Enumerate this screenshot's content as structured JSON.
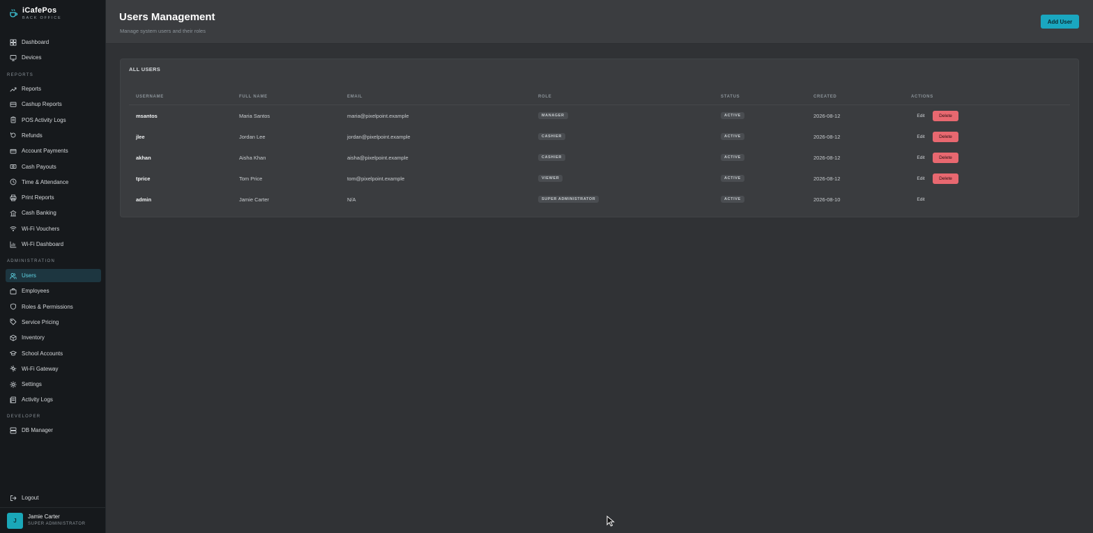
{
  "brand": {
    "name": "iCafePos",
    "subtitle": "BACK OFFICE"
  },
  "sidebar": {
    "top_items": [
      {
        "label": "Dashboard",
        "icon": "dashboard-icon"
      },
      {
        "label": "Devices",
        "icon": "monitor-icon"
      }
    ],
    "reports_title": "REPORTS",
    "reports_items": [
      {
        "label": "Reports",
        "icon": "trend-icon"
      },
      {
        "label": "Cashup Reports",
        "icon": "register-icon"
      },
      {
        "label": "POS Activity Logs",
        "icon": "clipboard-icon"
      },
      {
        "label": "Refunds",
        "icon": "refund-icon"
      },
      {
        "label": "Account Payments",
        "icon": "card-icon"
      },
      {
        "label": "Cash Payouts",
        "icon": "cash-icon"
      },
      {
        "label": "Time & Attendance",
        "icon": "clock-icon"
      },
      {
        "label": "Print Reports",
        "icon": "printer-icon"
      },
      {
        "label": "Cash Banking",
        "icon": "bank-icon"
      },
      {
        "label": "Wi-Fi Vouchers",
        "icon": "wifi-icon"
      },
      {
        "label": "Wi-Fi Dashboard",
        "icon": "bar-chart-icon"
      }
    ],
    "admin_title": "ADMINISTRATION",
    "admin_items": [
      {
        "label": "Users",
        "icon": "users-icon",
        "active": true
      },
      {
        "label": "Employees",
        "icon": "briefcase-icon"
      },
      {
        "label": "Roles & Permissions",
        "icon": "shield-icon"
      },
      {
        "label": "Service Pricing",
        "icon": "tag-icon"
      },
      {
        "label": "Inventory",
        "icon": "box-icon"
      },
      {
        "label": "School Accounts",
        "icon": "graduation-cap-icon"
      },
      {
        "label": "Wi-Fi Gateway",
        "icon": "gateway-icon"
      },
      {
        "label": "Settings",
        "icon": "gear-icon"
      },
      {
        "label": "Activity Logs",
        "icon": "log-icon"
      }
    ],
    "developer_title": "DEVELOPER",
    "developer_items": [
      {
        "label": "DB Manager",
        "icon": "database-icon"
      }
    ],
    "logout_label": "Logout",
    "user": {
      "initial": "J",
      "name": "Jamie Carter",
      "role": "SUPER ADMINISTRATOR"
    }
  },
  "header": {
    "title": "Users Management",
    "subtitle": "Manage system users and their roles",
    "add_button": "Add User"
  },
  "table": {
    "title": "ALL USERS",
    "columns": [
      "USERNAME",
      "FULL NAME",
      "EMAIL",
      "ROLE",
      "STATUS",
      "CREATED",
      "ACTIONS"
    ],
    "edit_label": "Edit",
    "delete_label": "Delete",
    "rows": [
      {
        "username": "msantos",
        "full_name": "Maria Santos",
        "email": "maria@pixelpoint.example",
        "role": "MANAGER",
        "status": "ACTIVE",
        "created": "2026-08-12",
        "deletable": true
      },
      {
        "username": "jlee",
        "full_name": "Jordan Lee",
        "email": "jordan@pixelpoint.example",
        "role": "CASHIER",
        "status": "ACTIVE",
        "created": "2026-08-12",
        "deletable": true
      },
      {
        "username": "akhan",
        "full_name": "Aisha Khan",
        "email": "aisha@pixelpoint.example",
        "role": "CASHIER",
        "status": "ACTIVE",
        "created": "2026-08-12",
        "deletable": true
      },
      {
        "username": "tprice",
        "full_name": "Tom Price",
        "email": "tom@pixelpoint.example",
        "role": "VIEWER",
        "status": "ACTIVE",
        "created": "2026-08-12",
        "deletable": true
      },
      {
        "username": "admin",
        "full_name": "Jamie Carter",
        "email": "N/A",
        "role": "SUPER ADMINISTRATOR",
        "status": "ACTIVE",
        "created": "2026-08-10",
        "deletable": false
      }
    ]
  },
  "colors": {
    "accent": "#1aa7c0",
    "danger": "#e86870",
    "sidebar_bg": "#16191c",
    "main_bg": "#303235"
  }
}
